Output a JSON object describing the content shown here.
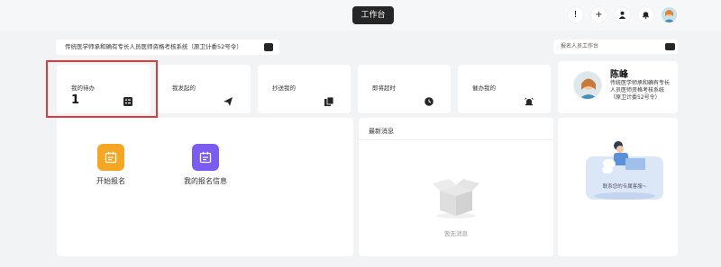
{
  "header": {
    "workspace_tab": "工作台",
    "icons": [
      "alert-icon",
      "plus-icon",
      "user-icon",
      "bell-icon",
      "avatar"
    ]
  },
  "system": {
    "title": "传统医学师承和确有专长人员医师资格考核系统（原卫计委52号令）",
    "role_select": "报名人员工作台"
  },
  "stats": [
    {
      "label": "我的待办",
      "count": "1",
      "icon": "todo-list-icon"
    },
    {
      "label": "我发起的",
      "count": "",
      "icon": "send-icon"
    },
    {
      "label": "抄送我的",
      "count": "",
      "icon": "copy-icon"
    },
    {
      "label": "即将超时",
      "count": "",
      "icon": "timeout-icon"
    },
    {
      "label": "催办我的",
      "count": "",
      "icon": "alarm-icon"
    }
  ],
  "profile": {
    "name": "陈峰",
    "system": "传统医学师承和确有专长人员医师资格考核系统（原卫计委52号令）"
  },
  "entries": [
    {
      "label": "开始报名",
      "color": "#f5a623"
    },
    {
      "label": "我的报名信息",
      "color": "#7b5cf0"
    }
  ],
  "messages": {
    "title": "最新消息",
    "empty": "暂无消息"
  },
  "contact": {
    "text": "联系您的专属客服~"
  },
  "colors": {
    "dark": "#262626",
    "highlight": "#e03a3a"
  }
}
